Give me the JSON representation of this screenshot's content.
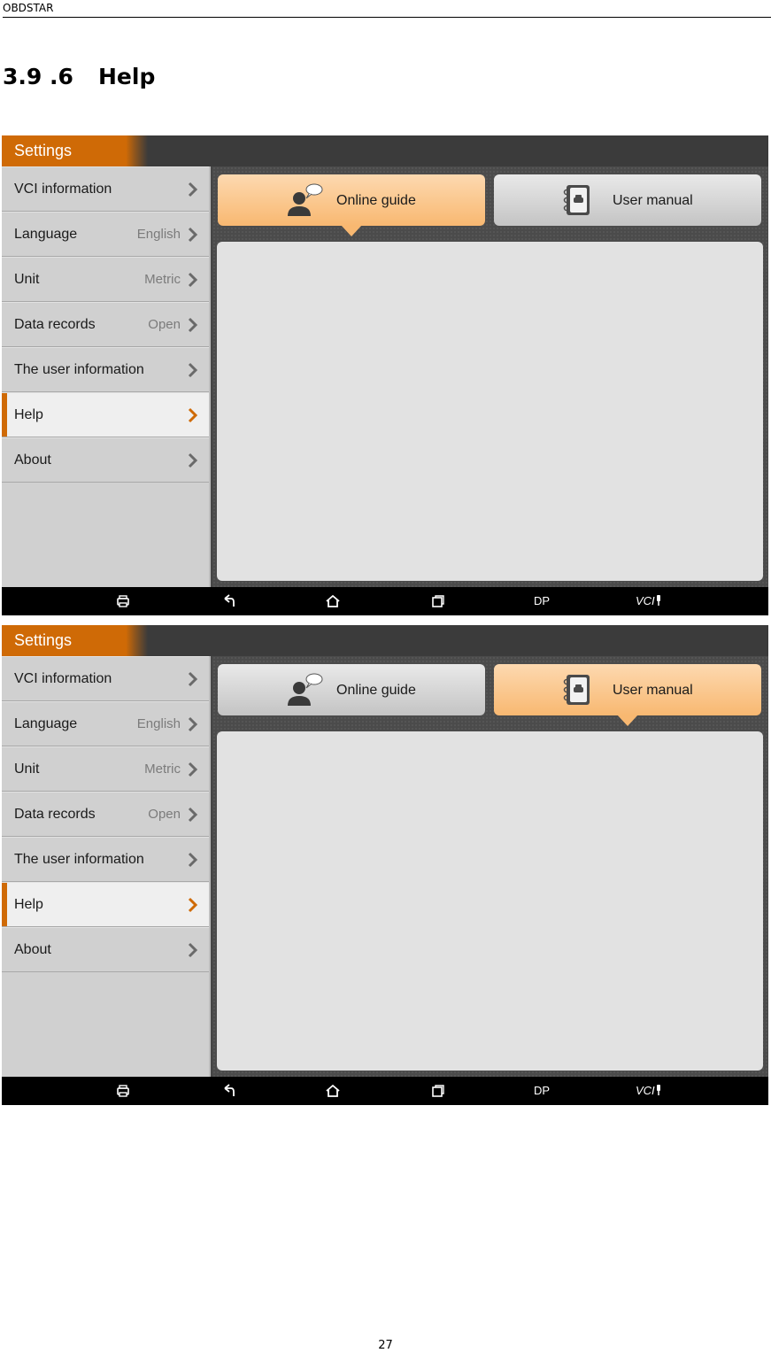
{
  "doc": {
    "header": "OBDSTAR",
    "section_number": "3.9 .6",
    "section_title": "Help",
    "page_number": "27"
  },
  "screens": [
    {
      "title": "Settings",
      "active_menu": "Help",
      "active_tab": "Online guide"
    },
    {
      "title": "Settings",
      "active_menu": "Help",
      "active_tab": "User manual"
    }
  ],
  "menu": [
    {
      "label": "VCI information",
      "value": ""
    },
    {
      "label": "Language",
      "value": "English"
    },
    {
      "label": "Unit",
      "value": "Metric"
    },
    {
      "label": "Data records",
      "value": "Open"
    },
    {
      "label": "The user information",
      "value": ""
    },
    {
      "label": "Help",
      "value": ""
    },
    {
      "label": "About",
      "value": ""
    }
  ],
  "tabs": {
    "online_guide": "Online guide",
    "user_manual": "User manual"
  },
  "navbar": {
    "dp": "DP",
    "vci": "VCI"
  },
  "colors": {
    "accent_orange": "#cf6a06",
    "active_tab": "#f8b871",
    "inactive_tab": "#d6d6d6"
  },
  "icons": [
    "chevron-right-icon",
    "online-guide-person-icon",
    "user-manual-book-icon",
    "printer-icon",
    "back-icon",
    "home-icon",
    "recent-apps-icon",
    "vci-connector-icon"
  ]
}
